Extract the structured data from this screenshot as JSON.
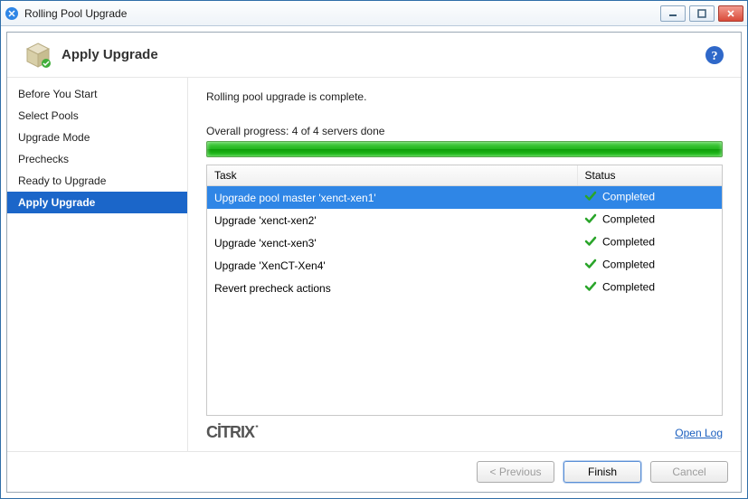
{
  "window": {
    "title": "Rolling Pool Upgrade"
  },
  "header": {
    "title": "Apply Upgrade"
  },
  "sidebar": {
    "items": [
      {
        "label": "Before You Start",
        "active": false
      },
      {
        "label": "Select Pools",
        "active": false
      },
      {
        "label": "Upgrade Mode",
        "active": false
      },
      {
        "label": "Prechecks",
        "active": false
      },
      {
        "label": "Ready to Upgrade",
        "active": false
      },
      {
        "label": "Apply Upgrade",
        "active": true
      }
    ]
  },
  "main": {
    "status_message": "Rolling pool upgrade is complete.",
    "overall_progress_label": "Overall progress: 4 of 4 servers done",
    "columns": {
      "task": "Task",
      "status": "Status"
    },
    "tasks": [
      {
        "name": "Upgrade pool master 'xenct-xen1'",
        "status": "Completed",
        "selected": true
      },
      {
        "name": "Upgrade 'xenct-xen2'",
        "status": "Completed",
        "selected": false
      },
      {
        "name": "Upgrade 'xenct-xen3'",
        "status": "Completed",
        "selected": false
      },
      {
        "name": "Upgrade 'XenCT-Xen4'",
        "status": "Completed",
        "selected": false
      },
      {
        "name": "Revert precheck actions",
        "status": "Completed",
        "selected": false
      }
    ],
    "open_log": "Open Log",
    "brand": "CİTRIX"
  },
  "buttons": {
    "previous": "< Previous",
    "finish": "Finish",
    "cancel": "Cancel"
  }
}
